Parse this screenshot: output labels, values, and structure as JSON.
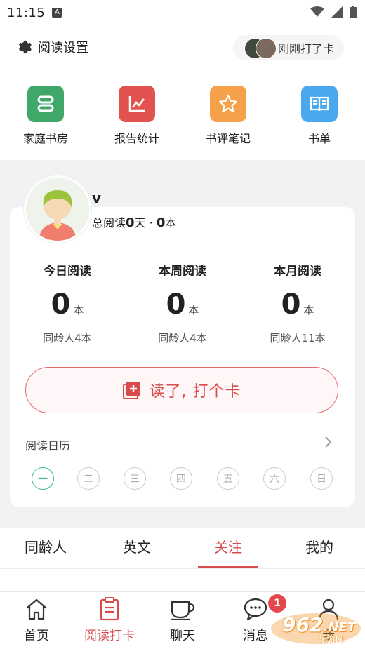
{
  "status_bar": {
    "time": "11:15"
  },
  "header": {
    "settings_label": "阅读设置",
    "checkin_label": "刚刚打了卡"
  },
  "quick_actions": [
    {
      "label": "家庭书房",
      "color": "#3fa869",
      "icon": "bookshelf-icon"
    },
    {
      "label": "报告统计",
      "color": "#e2524f",
      "icon": "chart-line-icon"
    },
    {
      "label": "书评笔记",
      "color": "#f5a14a",
      "icon": "star-icon"
    },
    {
      "label": "书单",
      "color": "#4aa8f0",
      "icon": "open-book-icon"
    }
  ],
  "user": {
    "name": "v",
    "total_prefix": "总阅读",
    "total_days": "0",
    "days_unit": "天 · ",
    "total_books": "0",
    "books_unit": "本"
  },
  "stats": [
    {
      "title": "今日阅读",
      "value": "0",
      "unit": "本",
      "peer": "同龄人4本"
    },
    {
      "title": "本周阅读",
      "value": "0",
      "unit": "本",
      "peer": "同龄人4本"
    },
    {
      "title": "本月阅读",
      "value": "0",
      "unit": "本",
      "peer": "同龄人11本"
    }
  ],
  "punch_button": {
    "label": "读了, 打个卡"
  },
  "calendar": {
    "title": "阅读日历",
    "days": [
      "一",
      "二",
      "三",
      "四",
      "五",
      "六",
      "日"
    ],
    "active_day": "一"
  },
  "tabs": {
    "items": [
      "同龄人",
      "英文",
      "关注",
      "我的"
    ],
    "active": "关注"
  },
  "bottom_nav": {
    "items": [
      {
        "label": "首页",
        "icon": "home-icon"
      },
      {
        "label": "阅读打卡",
        "icon": "reading-card-icon"
      },
      {
        "label": "聊天",
        "icon": "cup-icon"
      },
      {
        "label": "消息",
        "icon": "message-icon"
      },
      {
        "label": "我",
        "icon": "user-icon"
      }
    ],
    "active": "阅读打卡",
    "message_badge": "1"
  },
  "watermark": {
    "text": "962",
    "suffix": ".NET",
    "sub": "乐游网"
  },
  "colors": {
    "accent": "#d94b4b",
    "calendar_active": "#3bb89a"
  }
}
